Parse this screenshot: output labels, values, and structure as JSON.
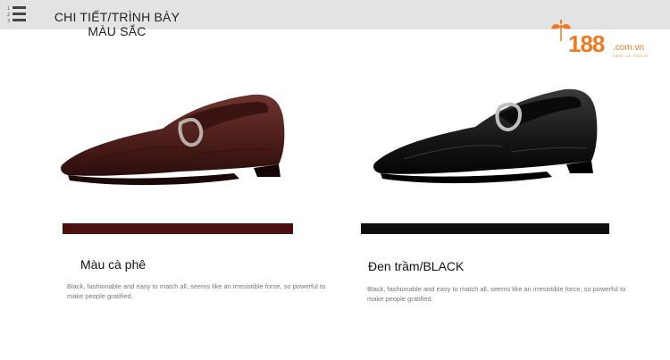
{
  "header": {
    "title": "CHI TIẾT/TRÌNH BÀY MÀU SẮC",
    "list_icon": "numbered-list-icon"
  },
  "logo": {
    "number": "188",
    "domain": ".com.vn",
    "tagline": "XEM LÀ THÍCH",
    "icon": "leaf-icon",
    "color": "#f07a1f"
  },
  "variants": [
    {
      "name": "Màu cà phê",
      "description": "Black, fashionable and easy to match all, seems like an irresistible force, so powerful to make people gratified.",
      "swatch_color": "#4a1010",
      "shoe_icon": "brown-monk-strap-shoe"
    },
    {
      "name": "Đen trầm/BLACK",
      "description": "Black, fashionable and easy to match all, seems like an irresistible force, so powerful to make people gratified.",
      "swatch_color": "#0e0e0e",
      "shoe_icon": "black-monk-strap-shoe"
    }
  ]
}
